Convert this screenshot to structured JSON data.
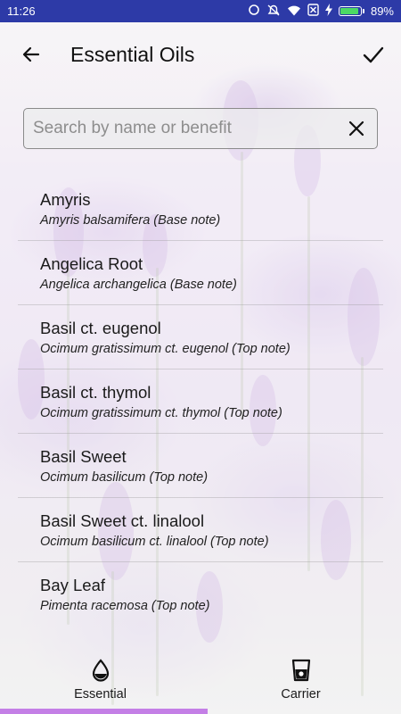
{
  "status_bar": {
    "time": "11:26",
    "battery_percent": "89%",
    "battery_level": 0.89,
    "icons": [
      "sync-icon",
      "do-not-disturb-icon",
      "wifi-icon",
      "no-sim-icon",
      "charging-icon",
      "battery-icon"
    ]
  },
  "app_bar": {
    "title": "Essential Oils",
    "back_icon": "arrow-back-icon",
    "confirm_icon": "check-icon"
  },
  "search": {
    "placeholder": "Search by name or benefit",
    "value": "",
    "clear_icon": "close-icon"
  },
  "oils": [
    {
      "name": "Amyris",
      "subtitle": "Amyris balsamifera (Base note)"
    },
    {
      "name": "Angelica Root",
      "subtitle": "Angelica archangelica (Base note)"
    },
    {
      "name": "Basil ct. eugenol",
      "subtitle": "Ocimum gratissimum ct. eugenol (Top note)"
    },
    {
      "name": "Basil ct. thymol",
      "subtitle": "Ocimum gratissimum ct. thymol (Top note)"
    },
    {
      "name": "Basil Sweet",
      "subtitle": "Ocimum basilicum (Top note)"
    },
    {
      "name": "Basil Sweet ct. linalool",
      "subtitle": "Ocimum basilicum ct. linalool (Top note)"
    },
    {
      "name": "Bay Leaf",
      "subtitle": "Pimenta racemosa (Top note)"
    }
  ],
  "bottom_nav": {
    "tabs": [
      {
        "label": "Essential",
        "icon": "drop-icon",
        "selected": true
      },
      {
        "label": "Carrier",
        "icon": "cup-icon",
        "selected": false
      }
    ]
  },
  "colors": {
    "status_bar": "#2d3aa7",
    "indicator": "#c47fe6",
    "battery_fill": "#4cd964"
  }
}
